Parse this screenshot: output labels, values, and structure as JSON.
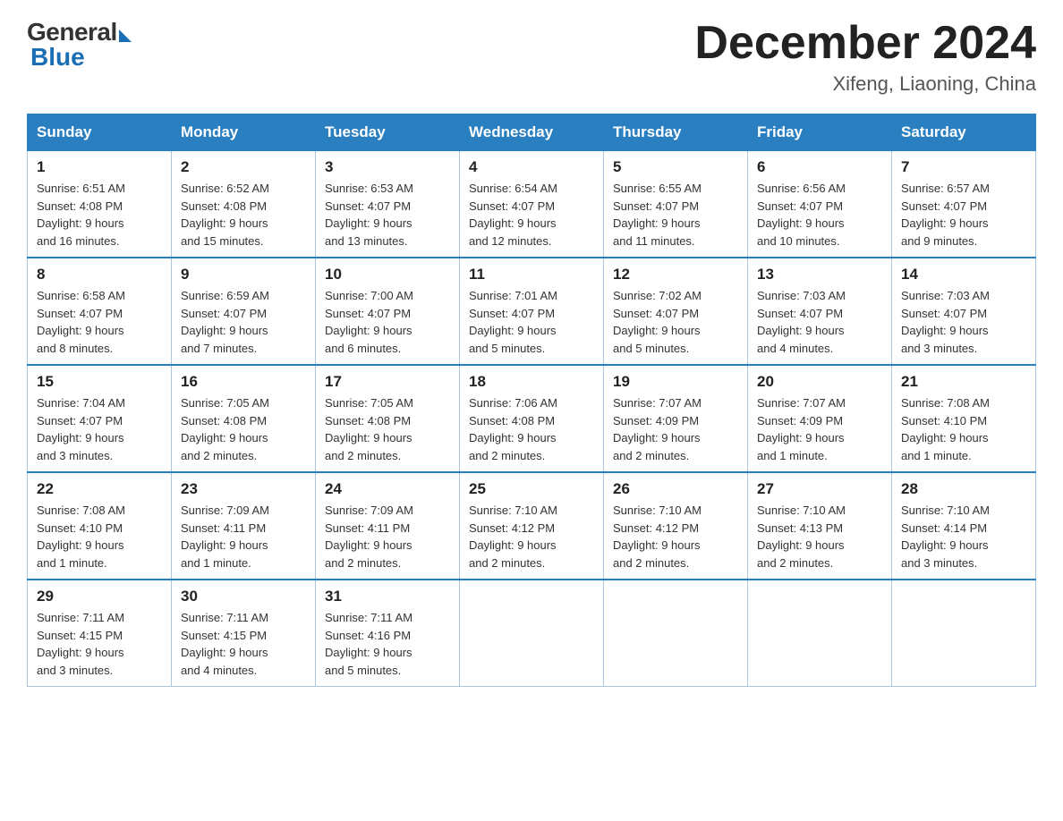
{
  "logo": {
    "general": "General",
    "blue": "Blue"
  },
  "title": "December 2024",
  "location": "Xifeng, Liaoning, China",
  "days_of_week": [
    "Sunday",
    "Monday",
    "Tuesday",
    "Wednesday",
    "Thursday",
    "Friday",
    "Saturday"
  ],
  "weeks": [
    [
      {
        "day": "1",
        "sunrise": "6:51 AM",
        "sunset": "4:08 PM",
        "daylight": "9 hours and 16 minutes."
      },
      {
        "day": "2",
        "sunrise": "6:52 AM",
        "sunset": "4:08 PM",
        "daylight": "9 hours and 15 minutes."
      },
      {
        "day": "3",
        "sunrise": "6:53 AM",
        "sunset": "4:07 PM",
        "daylight": "9 hours and 13 minutes."
      },
      {
        "day": "4",
        "sunrise": "6:54 AM",
        "sunset": "4:07 PM",
        "daylight": "9 hours and 12 minutes."
      },
      {
        "day": "5",
        "sunrise": "6:55 AM",
        "sunset": "4:07 PM",
        "daylight": "9 hours and 11 minutes."
      },
      {
        "day": "6",
        "sunrise": "6:56 AM",
        "sunset": "4:07 PM",
        "daylight": "9 hours and 10 minutes."
      },
      {
        "day": "7",
        "sunrise": "6:57 AM",
        "sunset": "4:07 PM",
        "daylight": "9 hours and 9 minutes."
      }
    ],
    [
      {
        "day": "8",
        "sunrise": "6:58 AM",
        "sunset": "4:07 PM",
        "daylight": "9 hours and 8 minutes."
      },
      {
        "day": "9",
        "sunrise": "6:59 AM",
        "sunset": "4:07 PM",
        "daylight": "9 hours and 7 minutes."
      },
      {
        "day": "10",
        "sunrise": "7:00 AM",
        "sunset": "4:07 PM",
        "daylight": "9 hours and 6 minutes."
      },
      {
        "day": "11",
        "sunrise": "7:01 AM",
        "sunset": "4:07 PM",
        "daylight": "9 hours and 5 minutes."
      },
      {
        "day": "12",
        "sunrise": "7:02 AM",
        "sunset": "4:07 PM",
        "daylight": "9 hours and 5 minutes."
      },
      {
        "day": "13",
        "sunrise": "7:03 AM",
        "sunset": "4:07 PM",
        "daylight": "9 hours and 4 minutes."
      },
      {
        "day": "14",
        "sunrise": "7:03 AM",
        "sunset": "4:07 PM",
        "daylight": "9 hours and 3 minutes."
      }
    ],
    [
      {
        "day": "15",
        "sunrise": "7:04 AM",
        "sunset": "4:07 PM",
        "daylight": "9 hours and 3 minutes."
      },
      {
        "day": "16",
        "sunrise": "7:05 AM",
        "sunset": "4:08 PM",
        "daylight": "9 hours and 2 minutes."
      },
      {
        "day": "17",
        "sunrise": "7:05 AM",
        "sunset": "4:08 PM",
        "daylight": "9 hours and 2 minutes."
      },
      {
        "day": "18",
        "sunrise": "7:06 AM",
        "sunset": "4:08 PM",
        "daylight": "9 hours and 2 minutes."
      },
      {
        "day": "19",
        "sunrise": "7:07 AM",
        "sunset": "4:09 PM",
        "daylight": "9 hours and 2 minutes."
      },
      {
        "day": "20",
        "sunrise": "7:07 AM",
        "sunset": "4:09 PM",
        "daylight": "9 hours and 1 minute."
      },
      {
        "day": "21",
        "sunrise": "7:08 AM",
        "sunset": "4:10 PM",
        "daylight": "9 hours and 1 minute."
      }
    ],
    [
      {
        "day": "22",
        "sunrise": "7:08 AM",
        "sunset": "4:10 PM",
        "daylight": "9 hours and 1 minute."
      },
      {
        "day": "23",
        "sunrise": "7:09 AM",
        "sunset": "4:11 PM",
        "daylight": "9 hours and 1 minute."
      },
      {
        "day": "24",
        "sunrise": "7:09 AM",
        "sunset": "4:11 PM",
        "daylight": "9 hours and 2 minutes."
      },
      {
        "day": "25",
        "sunrise": "7:10 AM",
        "sunset": "4:12 PM",
        "daylight": "9 hours and 2 minutes."
      },
      {
        "day": "26",
        "sunrise": "7:10 AM",
        "sunset": "4:12 PM",
        "daylight": "9 hours and 2 minutes."
      },
      {
        "day": "27",
        "sunrise": "7:10 AM",
        "sunset": "4:13 PM",
        "daylight": "9 hours and 2 minutes."
      },
      {
        "day": "28",
        "sunrise": "7:10 AM",
        "sunset": "4:14 PM",
        "daylight": "9 hours and 3 minutes."
      }
    ],
    [
      {
        "day": "29",
        "sunrise": "7:11 AM",
        "sunset": "4:15 PM",
        "daylight": "9 hours and 3 minutes."
      },
      {
        "day": "30",
        "sunrise": "7:11 AM",
        "sunset": "4:15 PM",
        "daylight": "9 hours and 4 minutes."
      },
      {
        "day": "31",
        "sunrise": "7:11 AM",
        "sunset": "4:16 PM",
        "daylight": "9 hours and 5 minutes."
      },
      null,
      null,
      null,
      null
    ]
  ]
}
